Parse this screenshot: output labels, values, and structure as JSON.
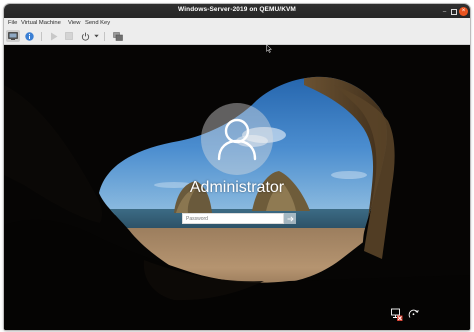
{
  "window": {
    "title": "Windows-Server-2019 on QEMU/KVM"
  },
  "menubar": {
    "items": [
      "File",
      "Virtual Machine",
      "View",
      "Send Key"
    ]
  },
  "toolbar": {
    "buttons": [
      "console-icon",
      "info-icon",
      "run-icon",
      "pause-icon",
      "power-icon",
      "dropdown-icon",
      "snapshot-icon"
    ]
  },
  "login": {
    "username": "Administrator",
    "password_placeholder": "Password"
  },
  "colors": {
    "titlebar": "#2b2b2b",
    "close_button": "#e95420",
    "menubar": "#ededed",
    "viewer_background": "#050505",
    "sky": "#3f86c9",
    "sea": "#2f5a72",
    "sand": "#b59470"
  },
  "icons": {
    "window": [
      "minimize-icon",
      "maximize-icon",
      "close-icon"
    ],
    "login": [
      "user-avatar-icon",
      "submit-arrow-icon"
    ],
    "lockscreen": [
      "network-icon",
      "ease-of-access-icon"
    ],
    "pointer": "mouse-cursor"
  }
}
